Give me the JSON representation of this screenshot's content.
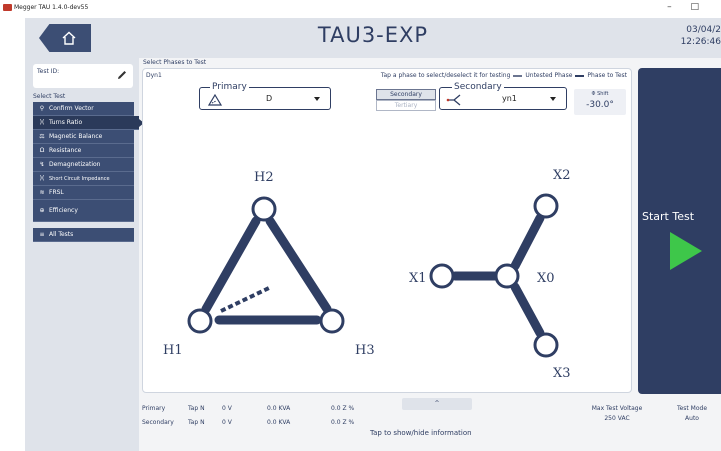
{
  "window": {
    "title": "Megger TAU 1.4.0-dev55",
    "controls": "– □"
  },
  "header": {
    "title": "TAU3-EXP",
    "date": "03/04/2",
    "time": "12:26:46"
  },
  "sidebar": {
    "test_id_label": "Test ID:",
    "select_test_label": "Select Test",
    "items": [
      {
        "label": "Confirm Vector",
        "icon": "search-icon"
      },
      {
        "label": "Turns Ratio",
        "icon": "coil-icon"
      },
      {
        "label": "Magnetic Balance",
        "icon": "balance-icon"
      },
      {
        "label": "Resistance",
        "icon": "omega-icon"
      },
      {
        "label": "Demagnetization",
        "icon": "demag-icon"
      },
      {
        "label": "Short Circuit Impedance",
        "icon": "coil-icon"
      },
      {
        "label": "FRSL",
        "icon": "frsl-icon"
      },
      {
        "label": "Efficiency",
        "icon": "efficiency-icon"
      },
      {
        "label": "All Tests",
        "icon": "list-icon"
      }
    ]
  },
  "phases": {
    "label": "Select Phases to Test",
    "vector_group": "Dyn1",
    "instruction": "Tap a phase to select/deselect it for testing",
    "legend_untested": "Untested Phase",
    "legend_test": "Phase to Test",
    "primary_label": "Primary",
    "primary_value": "D",
    "secondary_option": "Secondary",
    "tertiary_option": "Tertiary",
    "secondary_label": "Secondary",
    "secondary_value": "yn1",
    "shift_label": "Φ Shift",
    "shift_value": "-30.0°"
  },
  "diagram": {
    "primary_nodes": [
      "H1",
      "H2",
      "H3"
    ],
    "secondary_nodes": [
      "X0",
      "X1",
      "X2",
      "X3"
    ]
  },
  "start": {
    "label": "Start Test"
  },
  "info": {
    "rows": [
      {
        "side": "Primary",
        "tap": "Tap N",
        "voltage": "0 V",
        "power": "0.0 KVA",
        "impedance": "0.0 Z %"
      },
      {
        "side": "Secondary",
        "tap": "Tap N",
        "voltage": "0 V",
        "power": "0.0 KVA",
        "impedance": "0.0 Z %"
      }
    ],
    "expand_label": "^",
    "toggle_text": "Tap to show/hide information",
    "max_voltage_label": "Max Test Voltage",
    "max_voltage_value": "250 VAC",
    "mode_label": "Test Mode",
    "mode_value": "Auto"
  },
  "colors": {
    "accent": "#2f3e63",
    "start": "#3ec74a"
  }
}
